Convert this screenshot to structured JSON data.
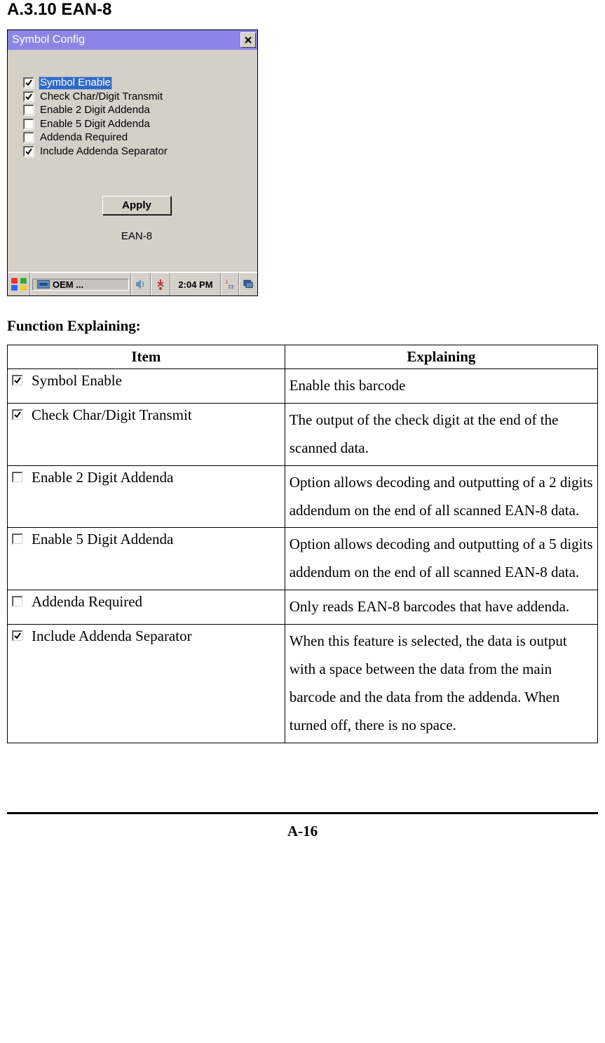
{
  "section_title": "A.3.10 EAN-8",
  "dialog": {
    "title": "Symbol Config",
    "close_glyph": "✕",
    "options": [
      {
        "label": "Symbol Enable",
        "checked": true,
        "selected": true
      },
      {
        "label": "Check Char/Digit Transmit",
        "checked": true,
        "selected": false
      },
      {
        "label": "Enable 2 Digit Addenda",
        "checked": false,
        "selected": false
      },
      {
        "label": "Enable 5 Digit Addenda",
        "checked": false,
        "selected": false
      },
      {
        "label": "Addenda Required",
        "checked": false,
        "selected": false
      },
      {
        "label": "Include Addenda Separator",
        "checked": true,
        "selected": false
      }
    ],
    "apply_label": "Apply",
    "subtitle": "EAN-8"
  },
  "taskbar": {
    "task_label": "OEM ...",
    "time": "2:04 PM"
  },
  "function_heading": "Function Explaining:",
  "table": {
    "headers": {
      "item": "Item",
      "explaining": "Explaining"
    },
    "rows": [
      {
        "checked": true,
        "item": "Symbol Enable",
        "explain": "Enable this barcode"
      },
      {
        "checked": true,
        "item": "Check Char/Digit Transmit",
        "explain": "The output of the check digit at the end of the scanned data."
      },
      {
        "checked": false,
        "item": "Enable 2 Digit Addenda",
        "explain": "Option allows decoding and outputting of a 2 digits addendum on the end of all scanned EAN-8 data."
      },
      {
        "checked": false,
        "item": "Enable 5 Digit Addenda",
        "explain": "Option allows decoding and outputting of a 5 digits addendum on the end of all scanned EAN-8 data."
      },
      {
        "checked": false,
        "item": "Addenda Required",
        "explain": "Only reads EAN-8 barcodes that have addenda."
      },
      {
        "checked": true,
        "item": "Include Addenda Separator",
        "explain": "When this feature is selected, the data is output with a space between the data from the main barcode and the data from the addenda. When turned off, there is no space."
      }
    ]
  },
  "page_number": "A-16"
}
